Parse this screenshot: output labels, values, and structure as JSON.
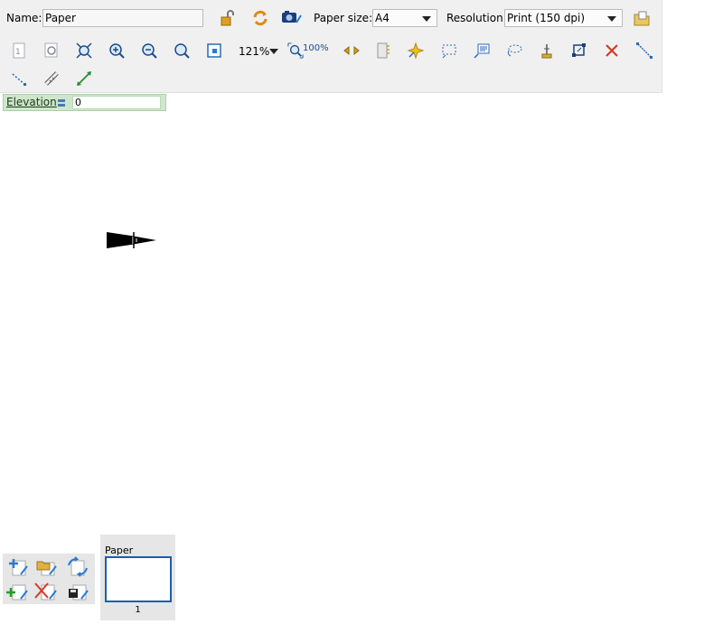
{
  "toolbar": {
    "name_label": "Name:",
    "name_value": "Paper",
    "paper_size_label": "Paper size:",
    "paper_size_value": "A4",
    "resolution_label": "Resolution:",
    "resolution_value": "Print (150 dpi)",
    "zoom_value": "121%",
    "zoom_100_label": "100%"
  },
  "elevation": {
    "label": "Elevation",
    "value": "0"
  },
  "pages": {
    "title": "Paper",
    "number": "1"
  },
  "colors": {
    "toolbar_bg": "#f0f0f0",
    "elevation_bg": "#cfe6cc",
    "thumb_border": "#1a5fa8",
    "accent_blue": "#2a7ad1",
    "delete_red": "#d23a2a"
  }
}
